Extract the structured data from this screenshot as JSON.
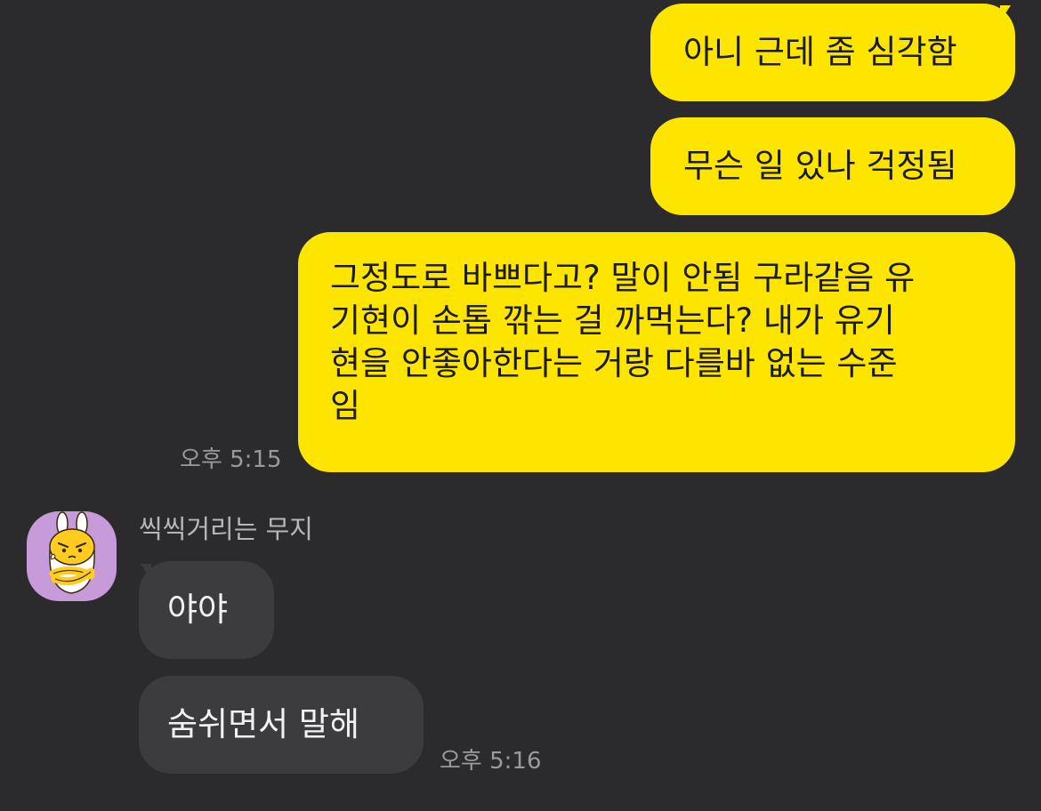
{
  "messages_out": [
    {
      "text": "아니 근데 좀 심각함"
    },
    {
      "text": "무슨 일 있나 걱정됨"
    },
    {
      "lines": [
        "그정도로 바쁘다고? 말이 안됨 구라같음 유",
        "기현이 손톱 깎는 걸 까먹는다? 내가 유기",
        "현을 안좋아한다는 거랑 다를바 없는 수준",
        "임"
      ]
    }
  ],
  "time_out": "오후 5:15",
  "contact": {
    "name": "씩씩거리는 무지",
    "avatar_icon": "muzi-character-avatar"
  },
  "messages_in": [
    {
      "text": "야야"
    },
    {
      "text": "숨쉬면서 말해"
    }
  ],
  "time_in": "오후 5:16",
  "colors": {
    "background": "#2b2b2d",
    "outgoing_bubble": "#fee500",
    "incoming_bubble": "#3c3c3e",
    "avatar_bg": "#c79ad9"
  }
}
